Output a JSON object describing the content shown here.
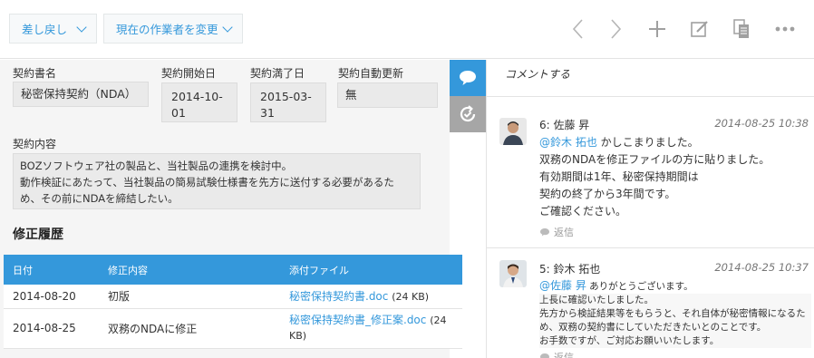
{
  "toolbar": {
    "revert_label": "差し戻し",
    "change_assignee_label": "現在の作業者を変更"
  },
  "fields": {
    "contract_name": {
      "label": "契約書名",
      "value": "秘密保持契約（NDA）"
    },
    "start_date": {
      "label": "契約開始日",
      "value_line1": "2014-10-",
      "value_line2": "01"
    },
    "end_date": {
      "label": "契約満了日",
      "value_line1": "2015-03-",
      "value_line2": "31"
    },
    "auto_renew": {
      "label": "契約自動更新",
      "value": "無"
    },
    "content": {
      "label": "契約内容",
      "lines": [
        "BOZソフトウェア社の製品と、当社製品の連携を検討中。",
        "動作検証にあたって、当社製品の簡易試験仕様書を先方に送付する必要があるた",
        "め、その前にNDAを締結したい。"
      ]
    }
  },
  "history": {
    "title": "修正履歴",
    "headers": [
      "日付",
      "修正内容",
      "添付ファイル"
    ],
    "rows": [
      {
        "date": "2014-08-20",
        "content": "初版",
        "file": "秘密保持契約書.doc",
        "size": "(24 KB)"
      },
      {
        "date": "2014-08-25",
        "content": "双務のNDAに修正",
        "file": "秘密保持契約書_修正案.doc",
        "size_a": "(24",
        "size_b": "KB)"
      }
    ]
  },
  "comments": {
    "placeholder": "コメントする",
    "reply_label": "返信",
    "items": [
      {
        "header": "6: 佐藤 昇",
        "time": "2014-08-25 10:38",
        "mention": "@鈴木 拓也",
        "first_line_rest": " かしこまりました。",
        "lines": [
          "双務のNDAを修正ファイルの方に貼りました。",
          "有効期間は1年、秘密保持期間は",
          "契約の終了から3年間です。",
          "ご確認ください。"
        ]
      },
      {
        "header": "5: 鈴木 拓也",
        "time": "2014-08-25 10:37",
        "mention": "@佐藤 昇",
        "first_line_rest": " ありがとうございます。",
        "lines": [
          "上長に確認いたしました。",
          "先方から検証結果等をもらうと、それ自体が秘密情報になるた",
          "め、双務の契約書にしていただきたいとのことです。",
          "お手数ですが、ご対応お願いいたします。"
        ]
      }
    ]
  },
  "colors": {
    "accent": "#3498db",
    "panel_bg": "#f5f5f5",
    "field_bg": "#eaeaea"
  },
  "icons": [
    "chevron-left-icon",
    "chevron-right-icon",
    "plus-icon",
    "edit-icon",
    "copy-icon",
    "more-icon",
    "comment-icon",
    "history-icon",
    "reply-icon"
  ]
}
